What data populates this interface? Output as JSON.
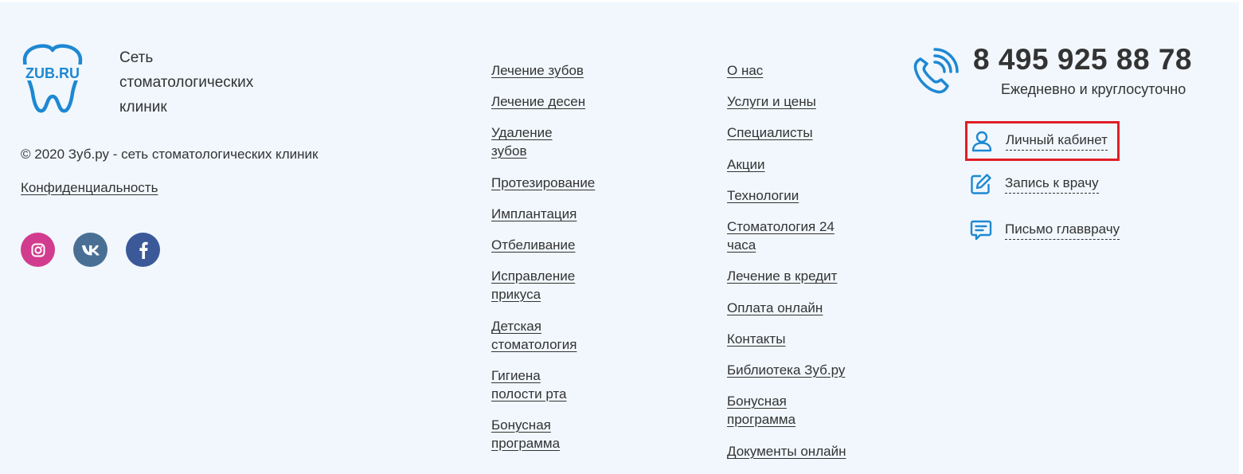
{
  "brand": {
    "logo_text": "ZUB.RU",
    "tagline": [
      "Сеть",
      "стоматологических",
      "клиник"
    ],
    "color": "#1e88d2"
  },
  "copyright": "© 2020 Зуб.ру - сеть стоматологических клиник",
  "privacy_link": "Конфиденциальность",
  "social": [
    {
      "name": "instagram-icon",
      "color": "#d23c8e"
    },
    {
      "name": "vk-icon",
      "color": "#4a6f95"
    },
    {
      "name": "facebook-icon",
      "color": "#3b5998"
    }
  ],
  "services_menu": [
    "Лечение зубов",
    "Лечение десен",
    "Удаление\nзубов",
    "Протезирование",
    "Имплантация",
    "Отбеливание",
    "Исправление\nприкуса",
    "Детская\nстоматология",
    "Гигиена\nполости рта",
    "Бонусная\nпрограмма"
  ],
  "info_menu": [
    "О нас",
    "Услуги и цены",
    "Специалисты",
    "Акции",
    "Технологии",
    "Стоматология 24\nчаса",
    "Лечение в кредит",
    "Оплата онлайн",
    "Контакты",
    "Библиотека Зуб.ру",
    "Бонусная\nпрограмма",
    "Документы онлайн"
  ],
  "contact": {
    "phone": "8 495 925 88 78",
    "hours": "Ежедневно и круглосуточно"
  },
  "actions": {
    "account": "Личный кабинет",
    "booking": "Запись к врачу",
    "letter": "Письмо главврачу"
  },
  "colors": {
    "background": "#f1f7fd",
    "accent": "#1e88d2",
    "highlight": "#e01e26"
  }
}
